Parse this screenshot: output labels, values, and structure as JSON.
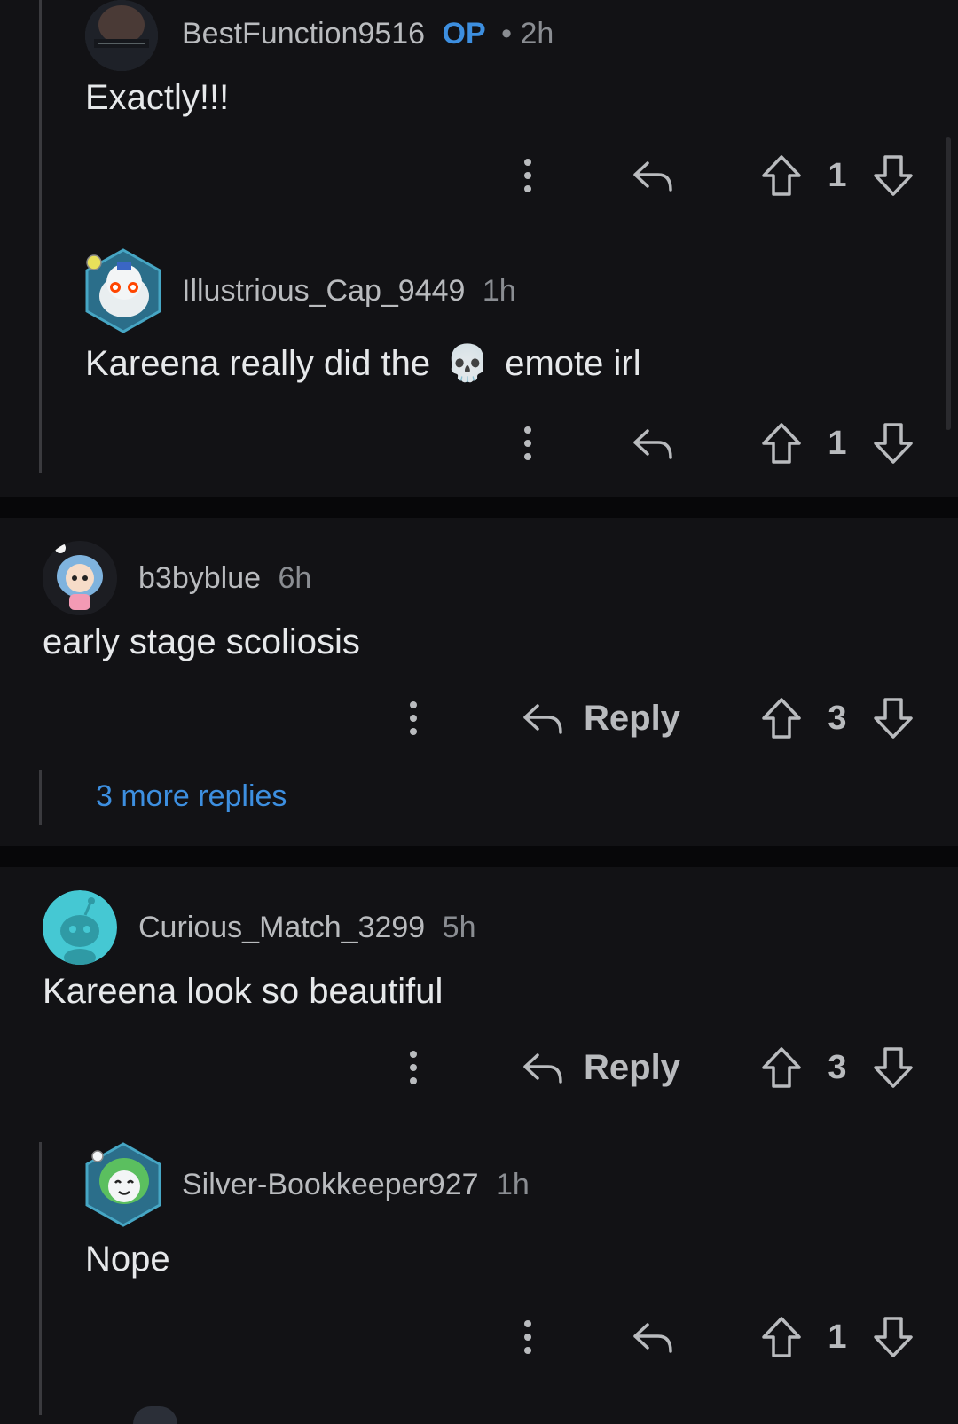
{
  "comments": [
    {
      "username": "BestFunction9516",
      "op_badge": "OP",
      "separator": "•",
      "time": "2h",
      "text": "Exactly!!!",
      "votes": "1"
    },
    {
      "username": "Illustrious_Cap_9449",
      "time": "1h",
      "text_before": "Kareena really did the",
      "emoji": "💀",
      "text_after": "emote irl",
      "votes": "1"
    },
    {
      "username": "b3byblue",
      "time": "6h",
      "text": "early stage scoliosis",
      "reply_label": "Reply",
      "votes": "3",
      "more_replies": "3 more replies"
    },
    {
      "username": "Curious_Match_3299",
      "time": "5h",
      "text": "Kareena look so beautiful",
      "reply_label": "Reply",
      "votes": "3"
    },
    {
      "username": "Silver-Bookkeeper927",
      "time": "1h",
      "text": "Nope",
      "votes": "1"
    }
  ],
  "colors": {
    "background": "#121215",
    "accent": "#3d8fe0",
    "muted": "#8a8d92"
  }
}
